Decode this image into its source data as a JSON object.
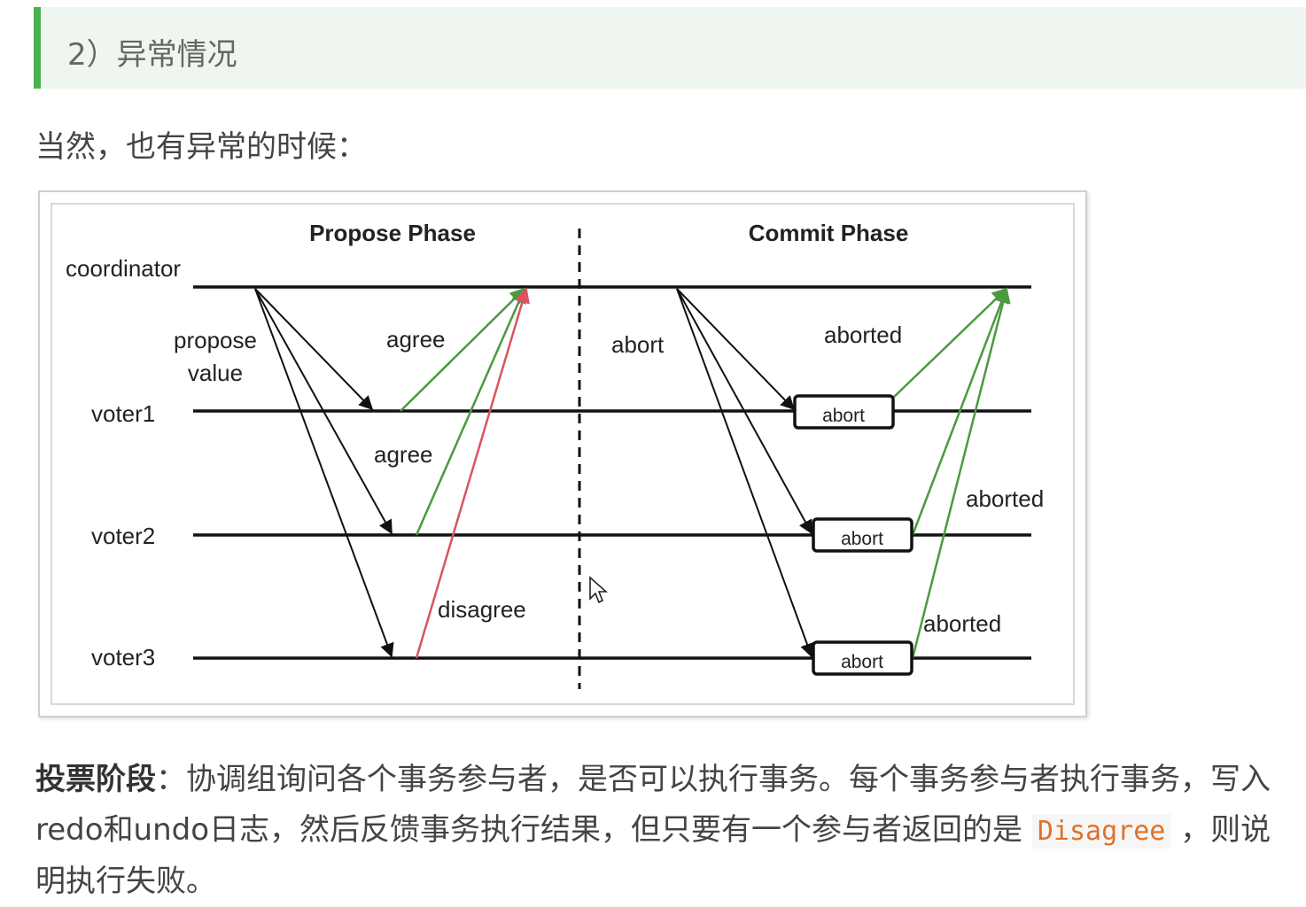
{
  "heading": "2）异常情况",
  "intro": "当然，也有异常的时候：",
  "diagram": {
    "propose_phase_title": "Propose Phase",
    "commit_phase_title": "Commit Phase",
    "coordinator_label": "coordinator",
    "voter1_label": "voter1",
    "voter2_label": "voter2",
    "voter3_label": "voter3",
    "propose_label_1": "propose",
    "propose_label_2": "value",
    "agree_label_1": "agree",
    "agree_label_2": "agree",
    "disagree_label": "disagree",
    "abort_label": "abort",
    "abort_box_1": "abort",
    "abort_box_2": "abort",
    "abort_box_3": "abort",
    "aborted_label_1": "aborted",
    "aborted_label_2": "aborted",
    "aborted_label_3": "aborted",
    "colors": {
      "agree": "#4a9a3f",
      "disagree": "#d9545e",
      "message": "#111111"
    }
  },
  "paragraph": {
    "bold": "投票阶段",
    "text1": "：协调组询问各个事务参与者，是否可以执行事务。每个事务参与者执行事务，写入redo和undo日志，然后反馈事务执行结果，但只要有一个参与者返回的是 ",
    "code": "Disagree",
    "text2": " ，则说明执行失败。"
  }
}
